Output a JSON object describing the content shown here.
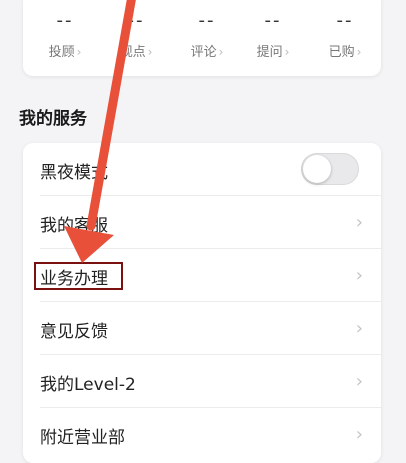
{
  "stats": [
    {
      "value": "--",
      "label": "投顾"
    },
    {
      "value": "--",
      "label": "观点"
    },
    {
      "value": "--",
      "label": "评论"
    },
    {
      "value": "--",
      "label": "提问"
    },
    {
      "value": "--",
      "label": "已购"
    }
  ],
  "section": {
    "title": "我的服务"
  },
  "services": {
    "items": [
      {
        "label": "黑夜模式",
        "control": "toggle",
        "on": false
      },
      {
        "label": "我的客服"
      },
      {
        "label": "业务办理"
      },
      {
        "label": "意见反馈"
      },
      {
        "label": "我的Level-2"
      },
      {
        "label": "附近营业部"
      }
    ]
  },
  "annotation": {
    "color": "#e8503a",
    "box_color": "#7a1010"
  },
  "icons": {
    "chevron": "›"
  }
}
